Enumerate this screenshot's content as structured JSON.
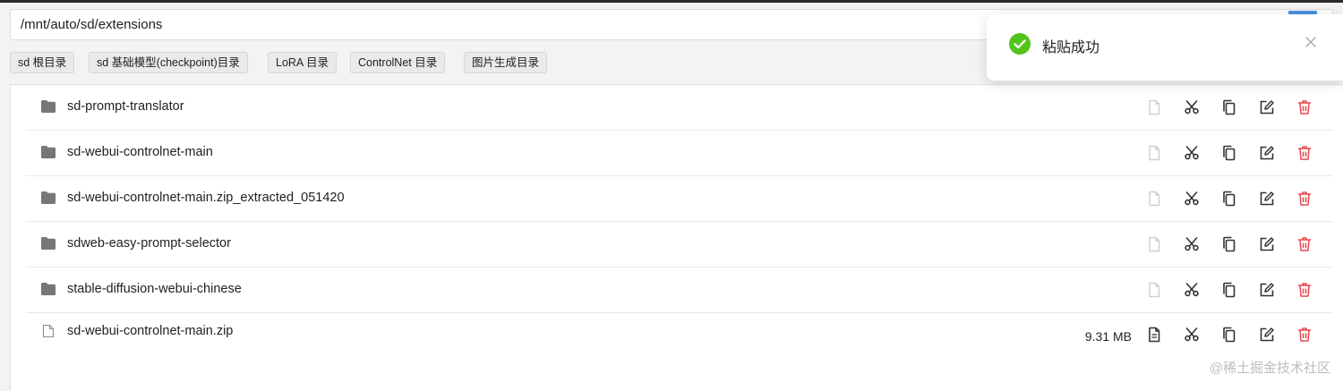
{
  "path": {
    "value": "/mnt/auto/sd/extensions"
  },
  "shortcuts": [
    "sd 根目录",
    "sd 基础模型(checkpoint)目录",
    "LoRA 目录",
    "ControlNet 目录",
    "图片生成目录"
  ],
  "files": [
    {
      "name": "sd-prompt-translator",
      "type": "folder",
      "size": ""
    },
    {
      "name": "sd-webui-controlnet-main",
      "type": "folder",
      "size": ""
    },
    {
      "name": "sd-webui-controlnet-main.zip_extracted_051420",
      "type": "folder",
      "size": ""
    },
    {
      "name": "sdweb-easy-prompt-selector",
      "type": "folder",
      "size": ""
    },
    {
      "name": "stable-diffusion-webui-chinese",
      "type": "folder",
      "size": ""
    },
    {
      "name": "sd-webui-controlnet-main.zip",
      "type": "file",
      "size": "9.31 MB"
    }
  ],
  "row_actions": [
    "file-view-icon",
    "scissors-icon",
    "copy-icon",
    "edit-icon",
    "trash-icon"
  ],
  "toast": {
    "message": "粘贴成功",
    "type": "success"
  },
  "watermark": "@稀土掘金技术社区",
  "colors": {
    "success": "#52c41a",
    "danger": "#e5484d",
    "folder": "#777777",
    "accent": "#4a90e2"
  }
}
